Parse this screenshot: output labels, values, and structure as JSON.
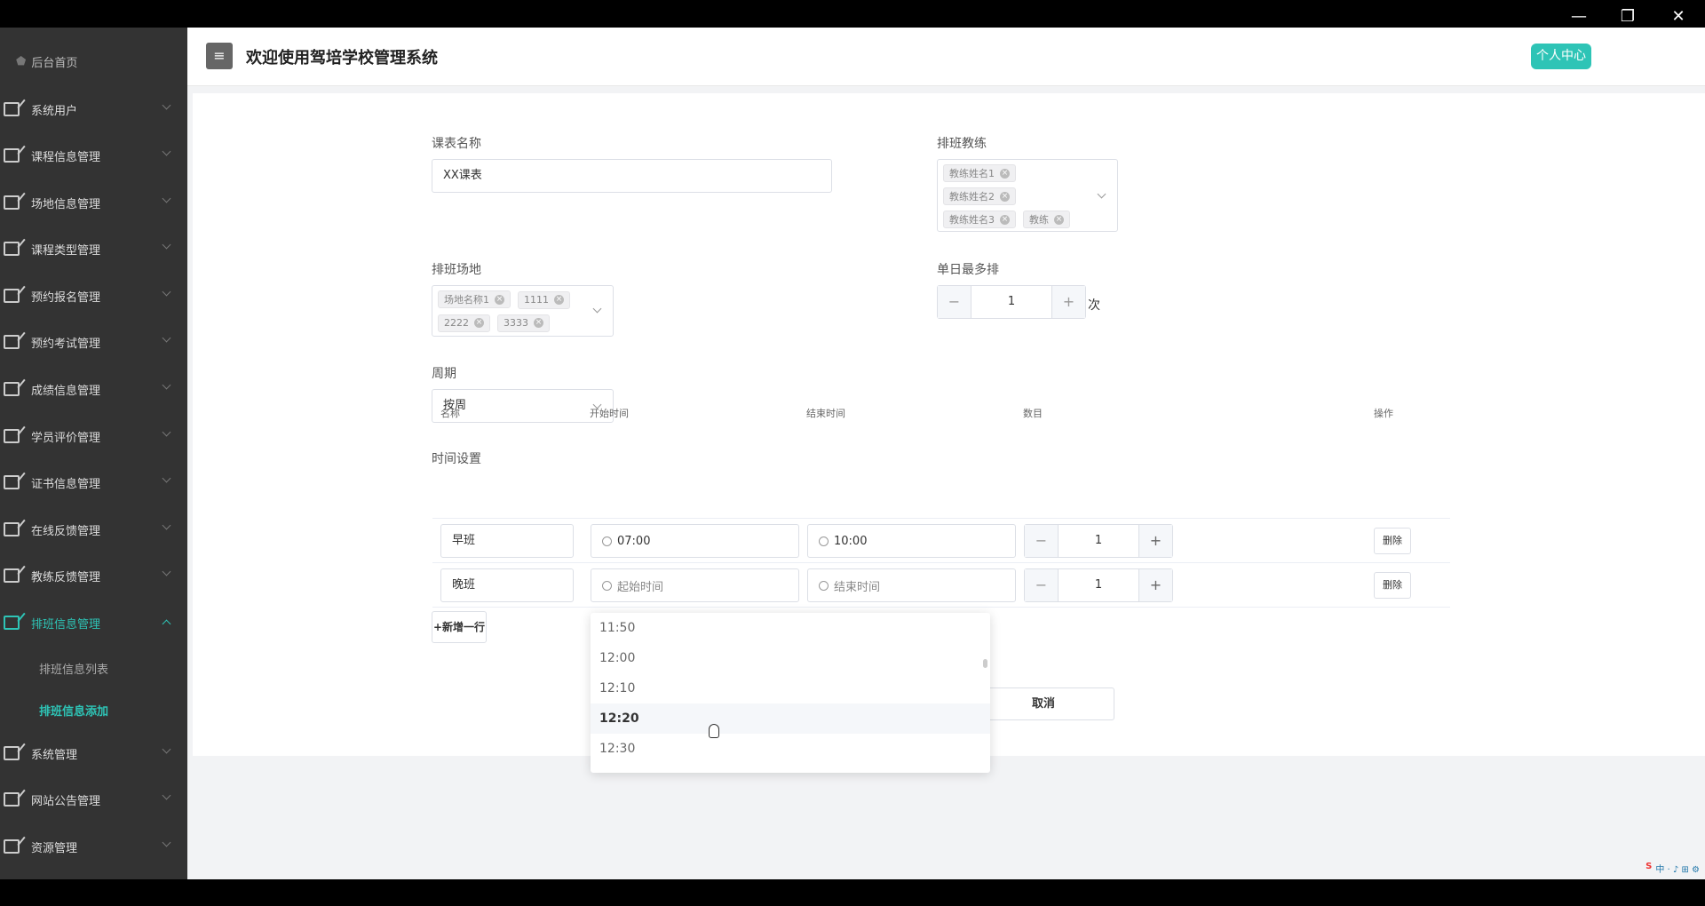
{
  "window": {
    "minimize": "—",
    "restore": "❐",
    "close": "✕"
  },
  "header": {
    "title": "欢迎使用驾培学校管理系统",
    "user_center": "个人中心"
  },
  "sidebar": {
    "home": "后台首页",
    "items": [
      {
        "label": "系统用户"
      },
      {
        "label": "课程信息管理"
      },
      {
        "label": "场地信息管理"
      },
      {
        "label": "课程类型管理"
      },
      {
        "label": "预约报名管理"
      },
      {
        "label": "预约考试管理"
      },
      {
        "label": "成绩信息管理"
      },
      {
        "label": "学员评价管理"
      },
      {
        "label": "证书信息管理"
      },
      {
        "label": "在线反馈管理"
      },
      {
        "label": "教练反馈管理"
      },
      {
        "label": "排班信息管理"
      },
      {
        "label": "系统管理"
      },
      {
        "label": "网站公告管理"
      },
      {
        "label": "资源管理"
      }
    ],
    "sub": [
      "排班信息列表",
      "排班信息添加"
    ]
  },
  "form": {
    "course_name_label": "课表名称",
    "course_name_value": "XX课表",
    "coach_label": "排班教练",
    "coaches": [
      "教练姓名1",
      "教练姓名2",
      "教练姓名3",
      "教练"
    ],
    "venue_label": "排班场地",
    "venues": [
      "场地名称1",
      "1111",
      "2222",
      "3333"
    ],
    "max_label": "单日最多排",
    "max_value": "1",
    "max_unit": "次",
    "cycle_label": "周期",
    "cycle_value": "按周",
    "time_label": "时间设置",
    "columns": [
      "名称",
      "开始时间",
      "结束时间",
      "数目",
      "操作"
    ],
    "rows": [
      {
        "name": "早班",
        "start": "07:00",
        "end": "10:00",
        "count": "1",
        "action": "删除"
      },
      {
        "name": "晚班",
        "start": "起始时间",
        "end": "结束时间",
        "count": "1",
        "action": "删除"
      }
    ],
    "add_row": "+新增一行",
    "cancel": "取消"
  },
  "dropdown": {
    "options": [
      "11:50",
      "12:00",
      "12:10",
      "12:20",
      "12:30"
    ],
    "highlighted": "12:20"
  },
  "stepper": {
    "minus": "−",
    "plus": "+"
  }
}
